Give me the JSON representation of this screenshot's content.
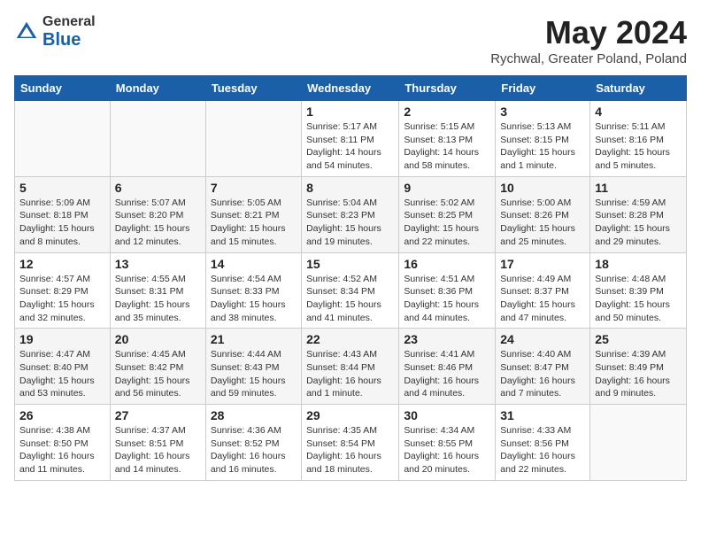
{
  "header": {
    "logo_general": "General",
    "logo_blue": "Blue",
    "month_title": "May 2024",
    "location": "Rychwal, Greater Poland, Poland"
  },
  "weekdays": [
    "Sunday",
    "Monday",
    "Tuesday",
    "Wednesday",
    "Thursday",
    "Friday",
    "Saturday"
  ],
  "weeks": [
    [
      {
        "day": "",
        "info": ""
      },
      {
        "day": "",
        "info": ""
      },
      {
        "day": "",
        "info": ""
      },
      {
        "day": "1",
        "info": "Sunrise: 5:17 AM\nSunset: 8:11 PM\nDaylight: 14 hours\nand 54 minutes."
      },
      {
        "day": "2",
        "info": "Sunrise: 5:15 AM\nSunset: 8:13 PM\nDaylight: 14 hours\nand 58 minutes."
      },
      {
        "day": "3",
        "info": "Sunrise: 5:13 AM\nSunset: 8:15 PM\nDaylight: 15 hours\nand 1 minute."
      },
      {
        "day": "4",
        "info": "Sunrise: 5:11 AM\nSunset: 8:16 PM\nDaylight: 15 hours\nand 5 minutes."
      }
    ],
    [
      {
        "day": "5",
        "info": "Sunrise: 5:09 AM\nSunset: 8:18 PM\nDaylight: 15 hours\nand 8 minutes."
      },
      {
        "day": "6",
        "info": "Sunrise: 5:07 AM\nSunset: 8:20 PM\nDaylight: 15 hours\nand 12 minutes."
      },
      {
        "day": "7",
        "info": "Sunrise: 5:05 AM\nSunset: 8:21 PM\nDaylight: 15 hours\nand 15 minutes."
      },
      {
        "day": "8",
        "info": "Sunrise: 5:04 AM\nSunset: 8:23 PM\nDaylight: 15 hours\nand 19 minutes."
      },
      {
        "day": "9",
        "info": "Sunrise: 5:02 AM\nSunset: 8:25 PM\nDaylight: 15 hours\nand 22 minutes."
      },
      {
        "day": "10",
        "info": "Sunrise: 5:00 AM\nSunset: 8:26 PM\nDaylight: 15 hours\nand 25 minutes."
      },
      {
        "day": "11",
        "info": "Sunrise: 4:59 AM\nSunset: 8:28 PM\nDaylight: 15 hours\nand 29 minutes."
      }
    ],
    [
      {
        "day": "12",
        "info": "Sunrise: 4:57 AM\nSunset: 8:29 PM\nDaylight: 15 hours\nand 32 minutes."
      },
      {
        "day": "13",
        "info": "Sunrise: 4:55 AM\nSunset: 8:31 PM\nDaylight: 15 hours\nand 35 minutes."
      },
      {
        "day": "14",
        "info": "Sunrise: 4:54 AM\nSunset: 8:33 PM\nDaylight: 15 hours\nand 38 minutes."
      },
      {
        "day": "15",
        "info": "Sunrise: 4:52 AM\nSunset: 8:34 PM\nDaylight: 15 hours\nand 41 minutes."
      },
      {
        "day": "16",
        "info": "Sunrise: 4:51 AM\nSunset: 8:36 PM\nDaylight: 15 hours\nand 44 minutes."
      },
      {
        "day": "17",
        "info": "Sunrise: 4:49 AM\nSunset: 8:37 PM\nDaylight: 15 hours\nand 47 minutes."
      },
      {
        "day": "18",
        "info": "Sunrise: 4:48 AM\nSunset: 8:39 PM\nDaylight: 15 hours\nand 50 minutes."
      }
    ],
    [
      {
        "day": "19",
        "info": "Sunrise: 4:47 AM\nSunset: 8:40 PM\nDaylight: 15 hours\nand 53 minutes."
      },
      {
        "day": "20",
        "info": "Sunrise: 4:45 AM\nSunset: 8:42 PM\nDaylight: 15 hours\nand 56 minutes."
      },
      {
        "day": "21",
        "info": "Sunrise: 4:44 AM\nSunset: 8:43 PM\nDaylight: 15 hours\nand 59 minutes."
      },
      {
        "day": "22",
        "info": "Sunrise: 4:43 AM\nSunset: 8:44 PM\nDaylight: 16 hours\nand 1 minute."
      },
      {
        "day": "23",
        "info": "Sunrise: 4:41 AM\nSunset: 8:46 PM\nDaylight: 16 hours\nand 4 minutes."
      },
      {
        "day": "24",
        "info": "Sunrise: 4:40 AM\nSunset: 8:47 PM\nDaylight: 16 hours\nand 7 minutes."
      },
      {
        "day": "25",
        "info": "Sunrise: 4:39 AM\nSunset: 8:49 PM\nDaylight: 16 hours\nand 9 minutes."
      }
    ],
    [
      {
        "day": "26",
        "info": "Sunrise: 4:38 AM\nSunset: 8:50 PM\nDaylight: 16 hours\nand 11 minutes."
      },
      {
        "day": "27",
        "info": "Sunrise: 4:37 AM\nSunset: 8:51 PM\nDaylight: 16 hours\nand 14 minutes."
      },
      {
        "day": "28",
        "info": "Sunrise: 4:36 AM\nSunset: 8:52 PM\nDaylight: 16 hours\nand 16 minutes."
      },
      {
        "day": "29",
        "info": "Sunrise: 4:35 AM\nSunset: 8:54 PM\nDaylight: 16 hours\nand 18 minutes."
      },
      {
        "day": "30",
        "info": "Sunrise: 4:34 AM\nSunset: 8:55 PM\nDaylight: 16 hours\nand 20 minutes."
      },
      {
        "day": "31",
        "info": "Sunrise: 4:33 AM\nSunset: 8:56 PM\nDaylight: 16 hours\nand 22 minutes."
      },
      {
        "day": "",
        "info": ""
      }
    ]
  ]
}
